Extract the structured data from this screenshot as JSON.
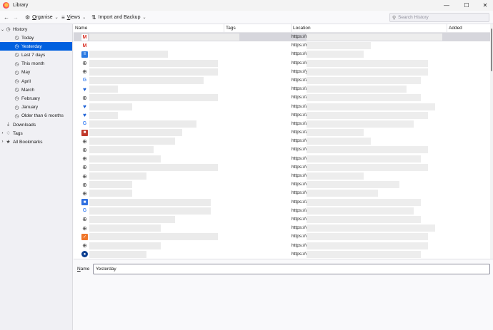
{
  "window": {
    "title": "Library",
    "controls": {
      "minimize": "—",
      "maximize": "☐",
      "close": "✕"
    }
  },
  "toolbar": {
    "back_icon": "arrow-left-icon",
    "forward_icon": "arrow-right-icon",
    "organise": {
      "underlined": "O",
      "rest": "rganise"
    },
    "views": {
      "underlined": "V",
      "rest": "iews"
    },
    "import": {
      "label": "Import and Backup"
    },
    "search": {
      "placeholder": "Search History",
      "value": ""
    }
  },
  "sidebar": {
    "history": "History",
    "items": [
      {
        "label": "Today"
      },
      {
        "label": "Yesterday",
        "selected": true
      },
      {
        "label": "Last 7 days"
      },
      {
        "label": "This month"
      },
      {
        "label": "May"
      },
      {
        "label": "April"
      },
      {
        "label": "March"
      },
      {
        "label": "February"
      },
      {
        "label": "January"
      },
      {
        "label": "Older than 6 months"
      }
    ],
    "downloads": "Downloads",
    "tags": "Tags",
    "all_bookmarks": "All Bookmarks"
  },
  "table": {
    "columns": {
      "name": "Name",
      "tags": "Tags",
      "location": "Location",
      "added": "Added"
    },
    "rows": [
      {
        "icon": "gmail-icon",
        "url": "https://r",
        "selected": true
      },
      {
        "icon": "gmail-icon",
        "url": "https://r"
      },
      {
        "icon": "document-icon",
        "url": "https://c"
      },
      {
        "icon": "globe-icon",
        "url": "https://c"
      },
      {
        "icon": "globe-icon",
        "url": "https://y"
      },
      {
        "icon": "google-icon",
        "url": "https://a"
      },
      {
        "icon": "bluebird-icon",
        "url": "https://a"
      },
      {
        "icon": "globe-icon",
        "url": "https://a"
      },
      {
        "icon": "bluebird-icon",
        "url": "https://a"
      },
      {
        "icon": "bluebird-icon",
        "url": "https://a"
      },
      {
        "icon": "google-icon",
        "url": "https://a"
      },
      {
        "icon": "red-square-icon",
        "url": "https://a"
      },
      {
        "icon": "globe-icon",
        "url": "https://v"
      },
      {
        "icon": "globe-icon",
        "url": "https://v"
      },
      {
        "icon": "globe-icon",
        "url": "https://v"
      },
      {
        "icon": "globe-icon",
        "url": "https://v"
      },
      {
        "icon": "globe-icon",
        "url": "https://v"
      },
      {
        "icon": "globe-icon",
        "url": "https://v"
      },
      {
        "icon": "globe-icon",
        "url": "https://v"
      },
      {
        "icon": "blue-square-icon",
        "url": "https://a"
      },
      {
        "icon": "google-icon",
        "url": "https://a"
      },
      {
        "icon": "globe-icon",
        "url": "https://v"
      },
      {
        "icon": "globe-icon",
        "url": "https://v"
      },
      {
        "icon": "orange-check-icon",
        "url": "https://v"
      },
      {
        "icon": "globe-icon",
        "url": "https://v"
      },
      {
        "icon": "navy-circle-icon",
        "url": "https://v"
      }
    ]
  },
  "details": {
    "name_label_underlined": "N",
    "name_label_rest": "ame",
    "name_value": "Yesterday"
  }
}
